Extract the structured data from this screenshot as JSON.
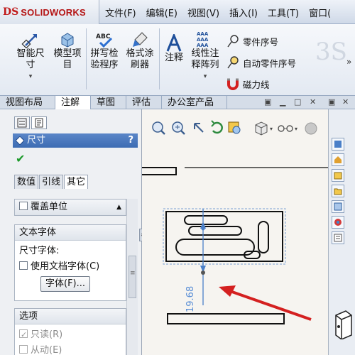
{
  "app": {
    "logo_mark": "DS",
    "logo_text": "SOLIDWORKS"
  },
  "menu": {
    "items": [
      "文件(F)",
      "编辑(E)",
      "视图(V)",
      "插入(I)",
      "工具(T)",
      "窗口("
    ]
  },
  "ribbon": {
    "smart_dimension": [
      "智能尺",
      "寸"
    ],
    "model_items": [
      "模型项",
      "目"
    ],
    "spell_check": [
      "拼写检",
      "验程序"
    ],
    "format_painter": [
      "格式涂",
      "刷器"
    ],
    "note": "注释",
    "linear_note_pattern": [
      "线性注",
      "释阵列"
    ],
    "spell_icon_text": "ABC",
    "balloon": "零件序号",
    "auto_balloon": "自动零件序号",
    "magnetic_line": "磁力线",
    "dropdown_glyph": "▾"
  },
  "command_tabs": [
    "视图布局",
    "注解",
    "草图",
    "评估",
    "办公室产品"
  ],
  "command_tabs_active": 1,
  "property_panel": {
    "title": "尺寸",
    "help": "?",
    "ok_glyph": "✔",
    "subtabs": [
      "数值",
      "引线",
      "其它"
    ],
    "override_units": "覆盖单位",
    "text_font_header": "文本字体",
    "dimension_font_label": "尺寸字体:",
    "use_document_font": "使用文档字体(C)",
    "font_button": "字体(F)...",
    "options_header": "选项",
    "read_only": "只读(R)",
    "driven": "从动(E)"
  },
  "drawing": {
    "dimension_value": "19.68"
  },
  "colors": {
    "accent_blue": "#3d6cb3",
    "arrow_red": "#d42020",
    "dimension_blue": "#4a7fc8"
  }
}
